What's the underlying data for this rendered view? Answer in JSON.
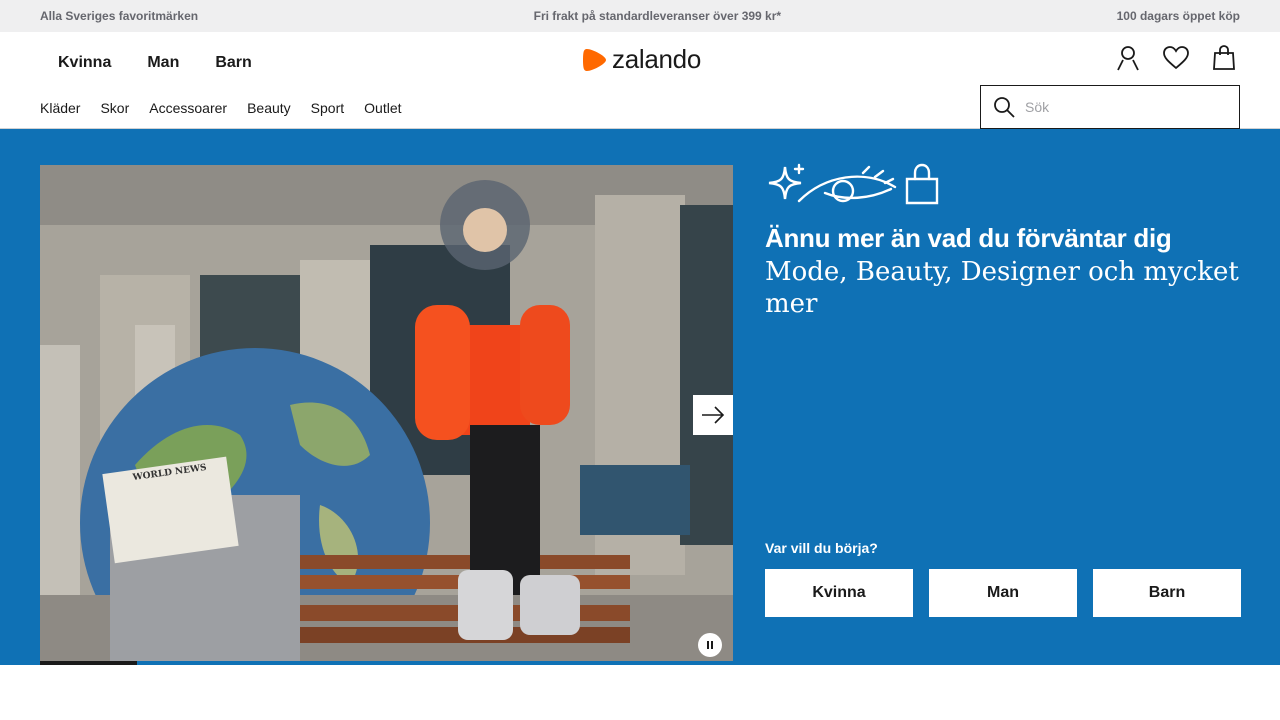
{
  "promo_bar": {
    "left": "Alla Sveriges favoritmärken",
    "center": "Fri frakt på standardleveranser över 399 kr*",
    "right": "100 dagars öppet köp"
  },
  "header": {
    "gender_nav": [
      "Kvinna",
      "Man",
      "Barn"
    ],
    "logo_text": "zalando",
    "category_nav": [
      "Kläder",
      "Skor",
      "Accessoarer",
      "Beauty",
      "Sport",
      "Outlet"
    ],
    "search": {
      "placeholder": "Sök",
      "value": ""
    },
    "icons": [
      "user-icon",
      "heart-icon",
      "bag-icon"
    ]
  },
  "hero": {
    "headline": "Ännu mer än vad du förväntar dig",
    "subline": "Mode, Beauty, Designer och mycket mer",
    "newspaper_text": "WORLD NEWS",
    "question": "Var vill du börja?",
    "buttons": [
      "Kvinna",
      "Man",
      "Barn"
    ],
    "carousel_progress": 0.14,
    "icons": [
      "sparkle-icon",
      "eye-icon",
      "shopping-bag-icon"
    ],
    "background_color": "#0f71b5"
  },
  "colors": {
    "brand_orange": "#ff6900",
    "hero_blue": "#0f71b5",
    "promo_bg": "#efeff0"
  }
}
